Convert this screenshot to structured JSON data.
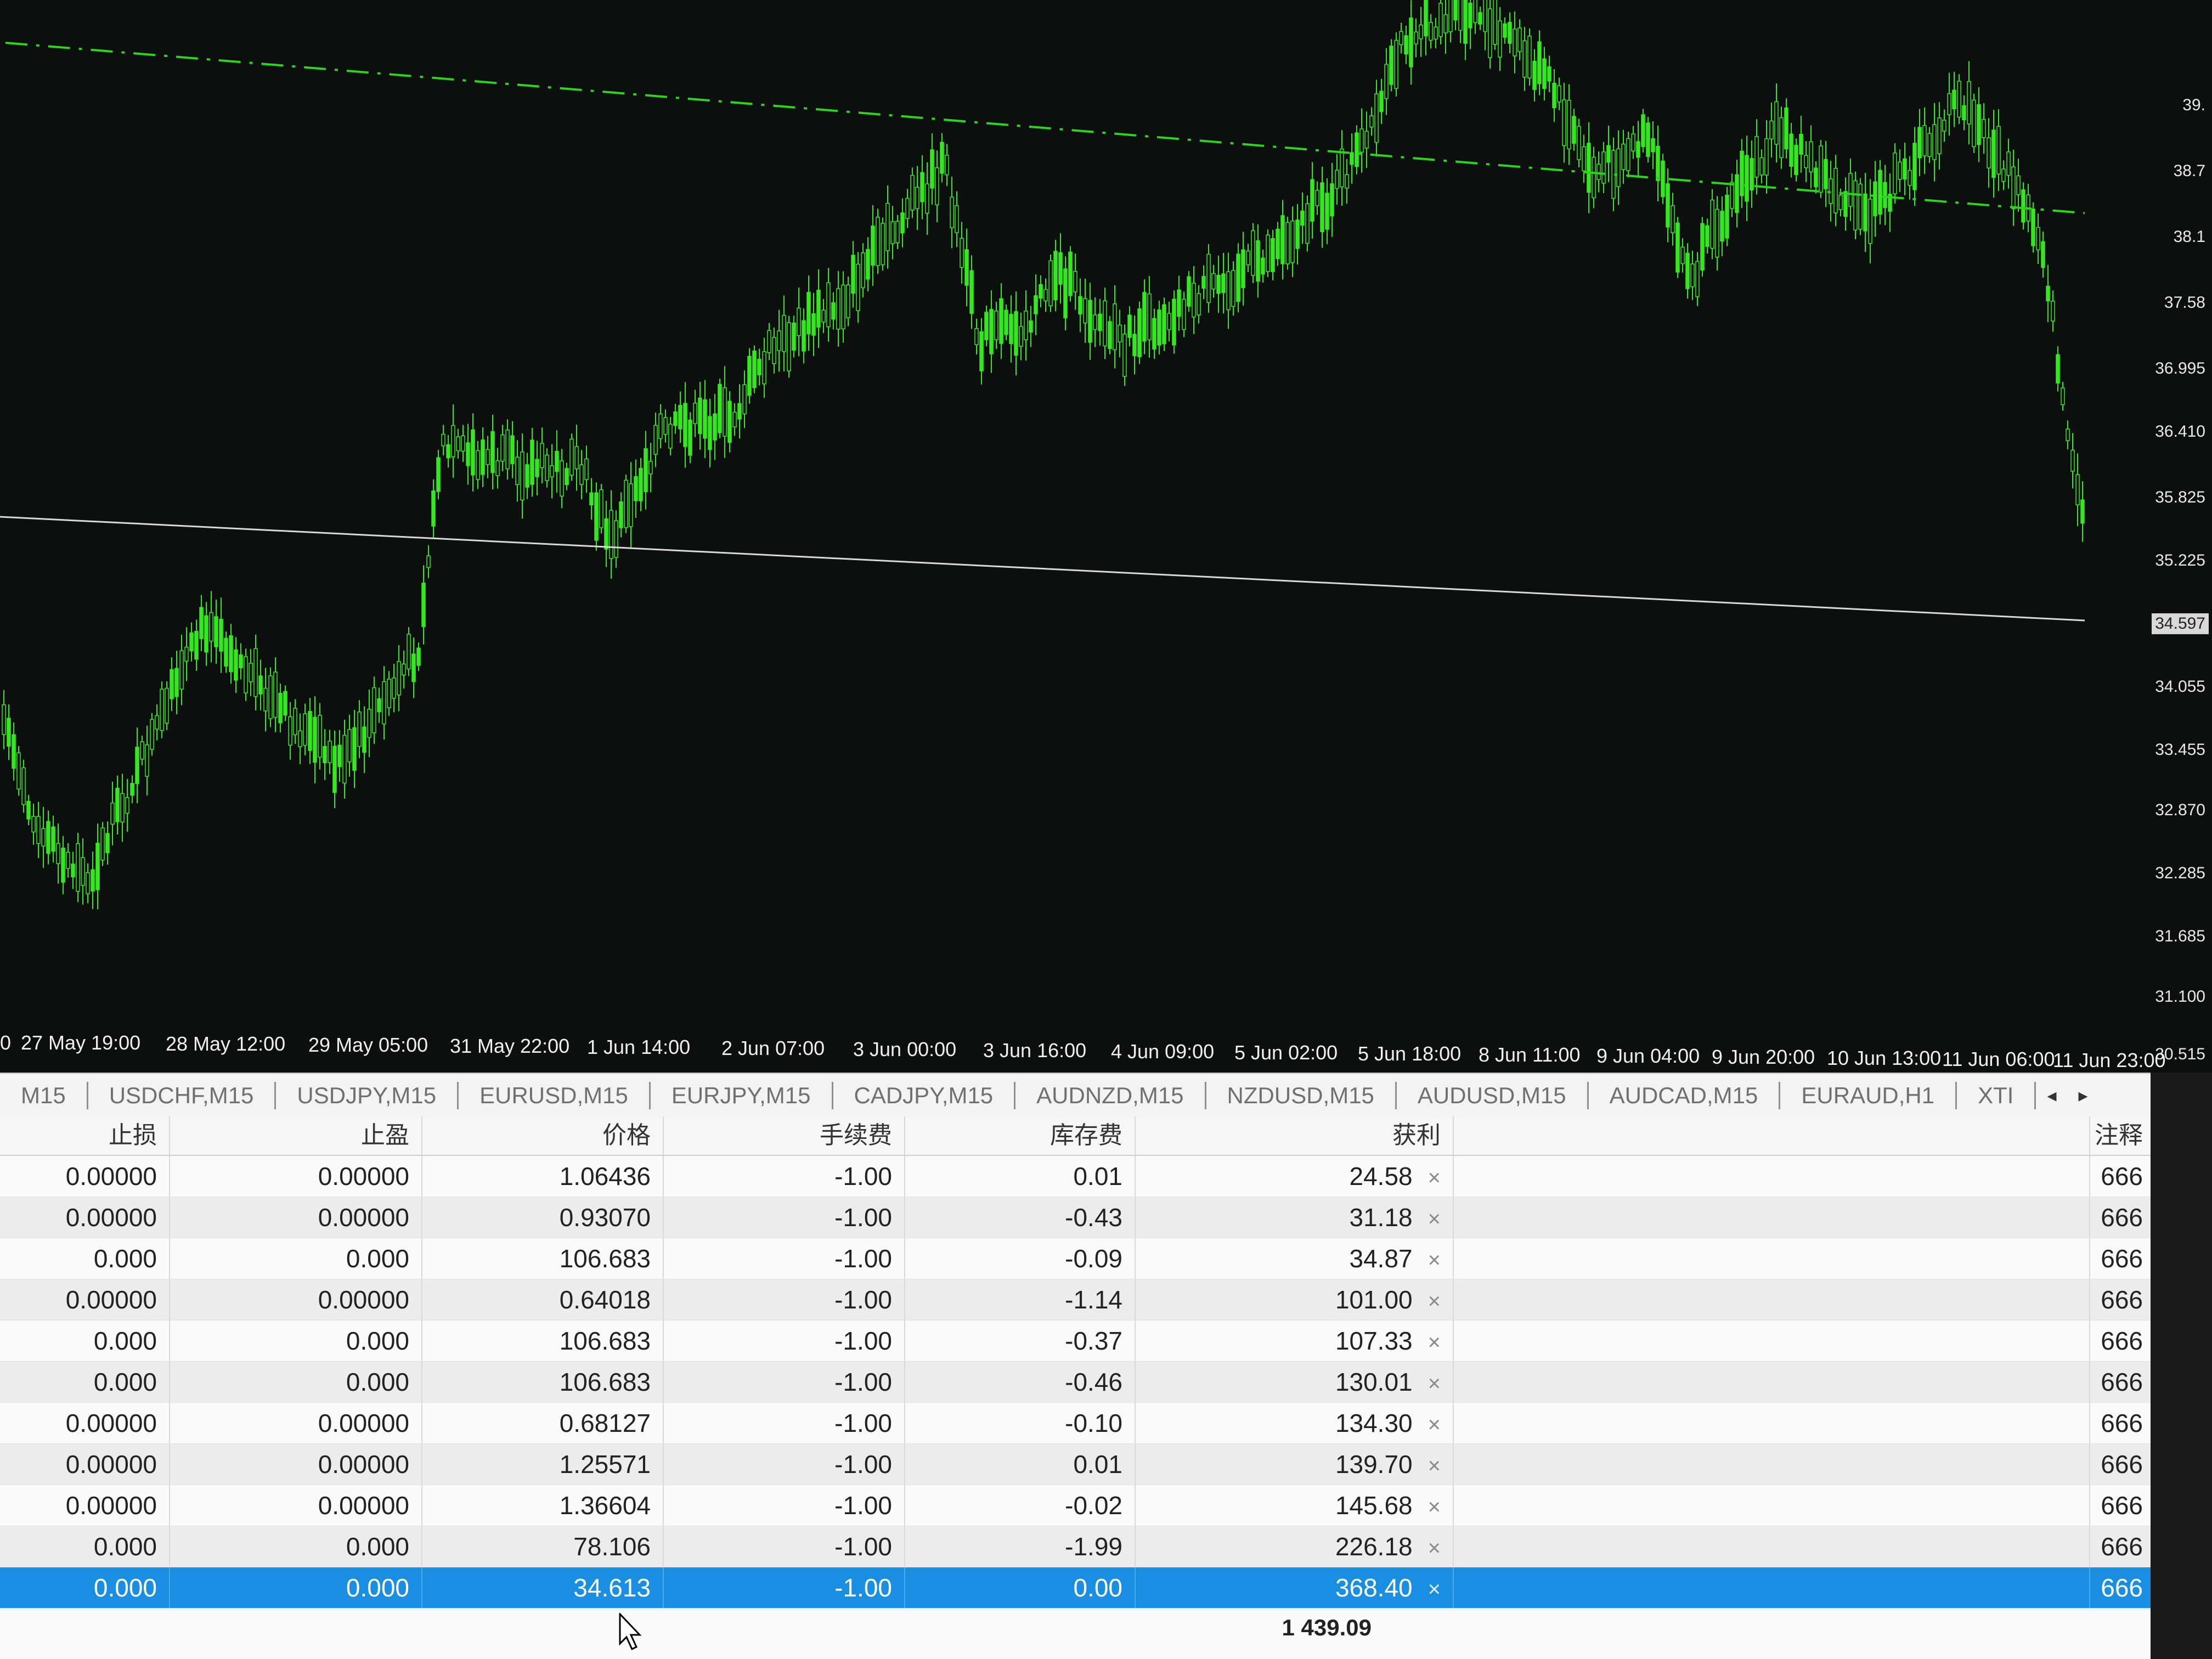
{
  "colors": {
    "chart_background": "#0d0f0e",
    "candle_color": "#33e81f",
    "resistance_line_color": "#2bd51a",
    "support_line_color": "#d9d9d9",
    "selected_row": "#1a8ee0"
  },
  "chart": {
    "price_axis_labels": [
      "39.",
      "38.7",
      "38.1",
      "37.58",
      "36.995",
      "36.410",
      "35.825",
      "35.225",
      "34.055",
      "33.455",
      "32.870",
      "32.285",
      "31.685",
      "31.100",
      "30.515"
    ],
    "current_price": "34.597",
    "time_axis_labels": [
      "0",
      "27 May 19:00",
      "28 May 12:00",
      "29 May 05:00",
      "31 May 22:00",
      "1 Jun 14:00",
      "2 Jun 07:00",
      "3 Jun 00:00",
      "3 Jun 16:00",
      "4 Jun 09:00",
      "5 Jun 02:00",
      "5 Jun 18:00",
      "8 Jun 11:00",
      "9 Jun 04:00",
      "9 Jun 20:00",
      "10 Jun 13:00",
      "11 Jun 06:00",
      "11 Jun 23:00"
    ]
  },
  "tabs": [
    "M15",
    "USDCHF,M15",
    "USDJPY,M15",
    "EURUSD,M15",
    "EURJPY,M15",
    "CADJPY,M15",
    "AUDNZD,M15",
    "NZDUSD,M15",
    "AUDUSD,M15",
    "AUDCAD,M15",
    "EURAUD,H1",
    "XTI"
  ],
  "tab_scroll_icons": [
    "arrow-left-icon",
    "arrow-right-icon"
  ],
  "terminal": {
    "headers": {
      "stop_loss": "止损",
      "take_profit": "止盈",
      "price": "价格",
      "commission": "手续费",
      "swap": "库存费",
      "profit": "获利",
      "comment": "注释"
    },
    "rows": [
      {
        "sl": "0.00000",
        "tp": "0.00000",
        "price": "1.06436",
        "commission": "-1.00",
        "swap": "0.01",
        "profit": "24.58",
        "comment": "666"
      },
      {
        "sl": "0.00000",
        "tp": "0.00000",
        "price": "0.93070",
        "commission": "-1.00",
        "swap": "-0.43",
        "profit": "31.18",
        "comment": "666"
      },
      {
        "sl": "0.000",
        "tp": "0.000",
        "price": "106.683",
        "commission": "-1.00",
        "swap": "-0.09",
        "profit": "34.87",
        "comment": "666"
      },
      {
        "sl": "0.00000",
        "tp": "0.00000",
        "price": "0.64018",
        "commission": "-1.00",
        "swap": "-1.14",
        "profit": "101.00",
        "comment": "666"
      },
      {
        "sl": "0.000",
        "tp": "0.000",
        "price": "106.683",
        "commission": "-1.00",
        "swap": "-0.37",
        "profit": "107.33",
        "comment": "666"
      },
      {
        "sl": "0.000",
        "tp": "0.000",
        "price": "106.683",
        "commission": "-1.00",
        "swap": "-0.46",
        "profit": "130.01",
        "comment": "666"
      },
      {
        "sl": "0.00000",
        "tp": "0.00000",
        "price": "0.68127",
        "commission": "-1.00",
        "swap": "-0.10",
        "profit": "134.30",
        "comment": "666"
      },
      {
        "sl": "0.00000",
        "tp": "0.00000",
        "price": "1.25571",
        "commission": "-1.00",
        "swap": "0.01",
        "profit": "139.70",
        "comment": "666"
      },
      {
        "sl": "0.00000",
        "tp": "0.00000",
        "price": "1.36604",
        "commission": "-1.00",
        "swap": "-0.02",
        "profit": "145.68",
        "comment": "666"
      },
      {
        "sl": "0.000",
        "tp": "0.000",
        "price": "78.106",
        "commission": "-1.00",
        "swap": "-1.99",
        "profit": "226.18",
        "comment": "666"
      },
      {
        "sl": "0.000",
        "tp": "0.000",
        "price": "34.613",
        "commission": "-1.00",
        "swap": "0.00",
        "profit": "368.40",
        "comment": "666",
        "selected": true
      }
    ],
    "close_icon": "×",
    "total_profit": "1 439.09"
  }
}
